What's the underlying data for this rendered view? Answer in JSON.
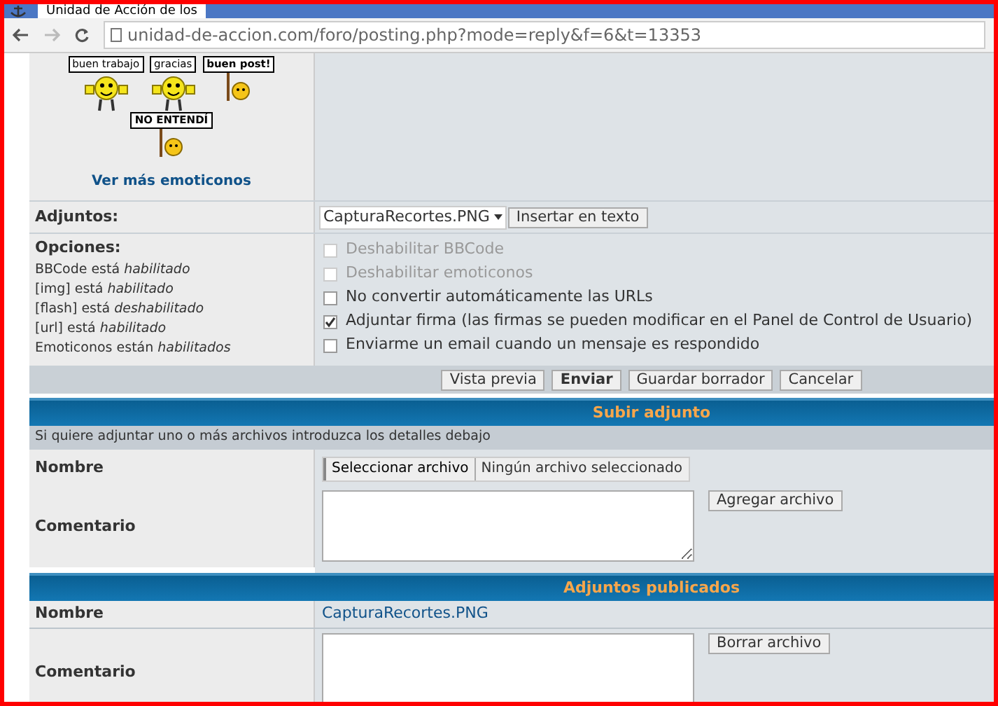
{
  "browser": {
    "tab_title": "Unidad de Acción de los",
    "url": "unidad-de-accion.com/foro/posting.php?mode=reply&f=6&t=13353"
  },
  "emoticons": {
    "items": [
      {
        "kind": "thumbs",
        "caption": "buen trabajo"
      },
      {
        "kind": "thumbs",
        "caption": "gracias"
      },
      {
        "kind": "sign",
        "caption": "buen post!"
      },
      {
        "kind": "sign",
        "caption": "NO ENTENDÍ"
      }
    ],
    "more_link": "Ver más emoticonos"
  },
  "attachments": {
    "label": "Adjuntos:",
    "select_value": "CapturaRecortes.PNG",
    "insert_button": "Insertar en texto"
  },
  "options": {
    "label": "Opciones:",
    "status": [
      {
        "text": "BBCode está *habilitado*"
      },
      {
        "text": "[img] está *habilitado*"
      },
      {
        "text": "[flash] está *deshabilitado*"
      },
      {
        "text": "[url] está *habilitado*"
      },
      {
        "text": "Emoticonos están *habilitados*"
      }
    ],
    "checkboxes": [
      {
        "label": "Deshabilitar BBCode",
        "checked": false,
        "disabled": true
      },
      {
        "label": "Deshabilitar emoticonos",
        "checked": false,
        "disabled": true
      },
      {
        "label": "No convertir automáticamente las URLs",
        "checked": false,
        "disabled": false
      },
      {
        "label": "Adjuntar firma (las firmas se pueden modificar en el Panel de Control de Usuario)",
        "checked": true,
        "disabled": false
      },
      {
        "label": "Enviarme un email cuando un mensaje es respondido",
        "checked": false,
        "disabled": false
      }
    ]
  },
  "action_buttons": [
    {
      "label": "Vista previa",
      "primary": false
    },
    {
      "label": "Enviar",
      "primary": true
    },
    {
      "label": "Guardar borrador",
      "primary": false
    },
    {
      "label": "Cancelar",
      "primary": false
    }
  ],
  "upload": {
    "header": "Subir adjunto",
    "hint": "Si quiere adjuntar uno o más archivos introduzca los detalles debajo",
    "name_label": "Nombre",
    "file_button": "Seleccionar archivo",
    "file_status": "Ningún archivo seleccionado",
    "comment_label": "Comentario",
    "add_button": "Agregar archivo"
  },
  "posted": {
    "header": "Adjuntos publicados",
    "name_label": "Nombre",
    "file_name": "CapturaRecortes.PNG",
    "comment_label": "Comentario",
    "delete_button": "Borrar archivo"
  }
}
